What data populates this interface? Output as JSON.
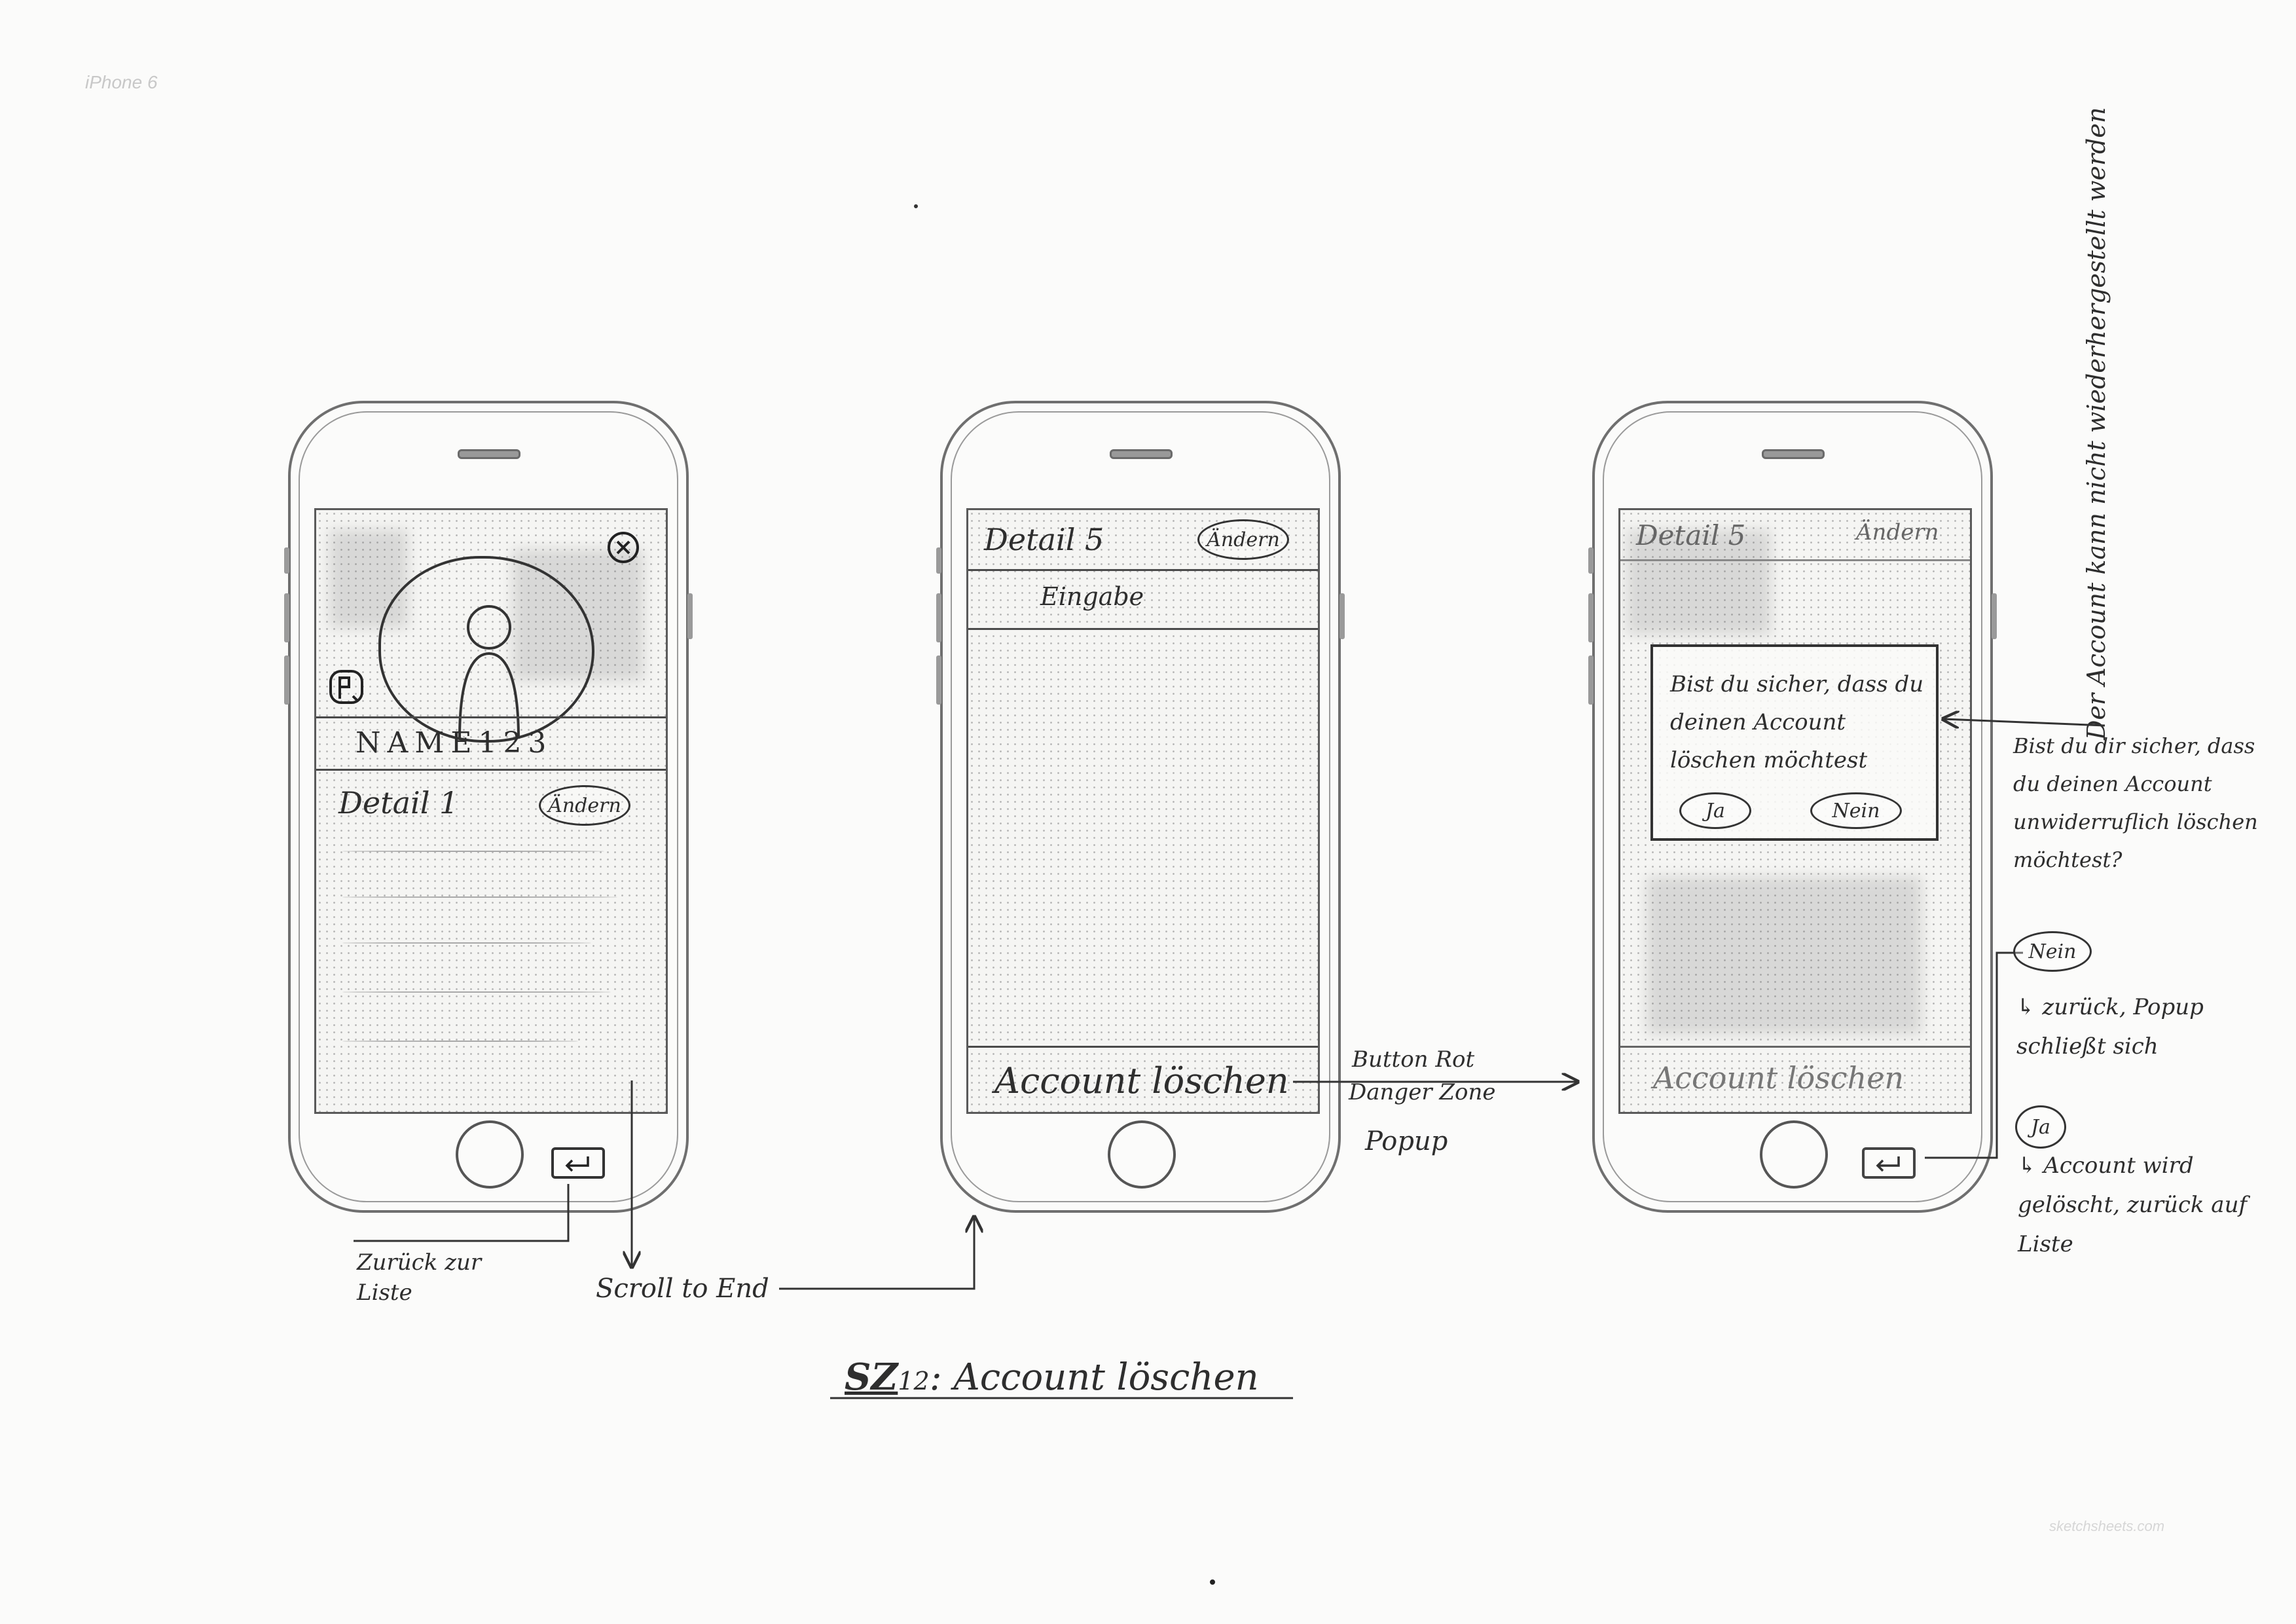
{
  "sheet": {
    "template_label": "iPhone 6",
    "footer_credit": "sketchsheets.com"
  },
  "title": {
    "prefix": "SZ",
    "number": "12",
    "rest": ": Account löschen"
  },
  "side_note": "Der Account kann nicht wiederhergestellt werden",
  "screen1": {
    "close_icon": "close-icon",
    "edit_photo_icon": "edit-photo-icon",
    "avatar_icon": "person-avatar-icon",
    "name": "NAME123",
    "detail_label": "Detail 1",
    "edit_button": "Ändern",
    "back_icon": "back-arrow-icon"
  },
  "screen2": {
    "detail_label": "Detail 5",
    "edit_button": "Ändern",
    "detail_value": "Eingabe",
    "delete_button": "Account löschen"
  },
  "screen3": {
    "detail_label": "Detail 5",
    "edit_button": "Ändern",
    "popup_text": "Bist du sicher, dass du deinen Account löschen möchtest",
    "yes_button": "Ja",
    "no_button": "Nein",
    "delete_button": "Account löschen",
    "back_icon": "back-arrow-icon"
  },
  "annotations": {
    "back_note": "Zurück zur Liste",
    "scroll_note": "Scroll to End",
    "button_note_line1": "Button Rot",
    "button_note_line2": "Danger Zone",
    "popup_note": "Popup",
    "popup_question": "Bist du dir sicher, dass du deinen Account unwiderruflich löschen möchtest?",
    "no_label": "Nein",
    "no_result": "↳ zurück, Popup schließt sich",
    "yes_label": "Ja",
    "yes_result": "↳ Account wird gelöscht, zurück auf Liste"
  }
}
